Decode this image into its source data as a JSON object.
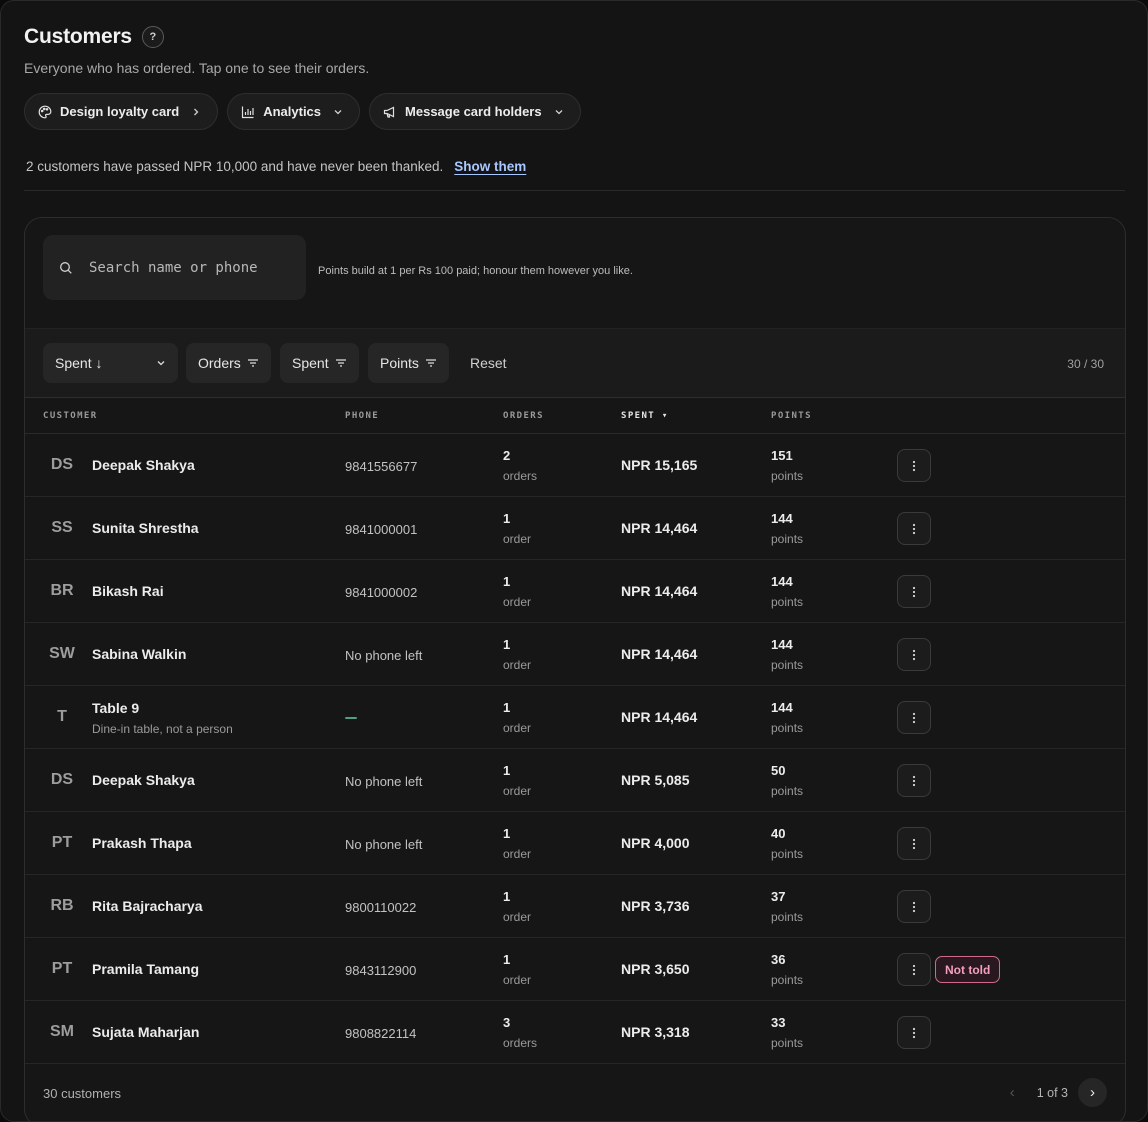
{
  "header": {
    "title": "Customers",
    "help": "?",
    "subtitle": "Everyone who has ordered. Tap one to see their orders."
  },
  "actions": [
    {
      "label": "Design loyalty card",
      "icon": "palette-icon",
      "trail": "chevron-right-icon"
    },
    {
      "label": "Analytics",
      "icon": "bar-chart-icon",
      "trail": "chevron-down-icon"
    },
    {
      "label": "Message card holders",
      "icon": "megaphone-icon",
      "trail": "chevron-down-icon"
    }
  ],
  "notice": {
    "text": "2 customers have passed NPR 10,000 and have never been thanked.",
    "link": "Show them"
  },
  "search": {
    "placeholder": "Search name or phone",
    "value": ""
  },
  "points_note": "Points build at 1 per Rs 100 paid; honour them however you like.",
  "filters": {
    "sort": "Spent ↓",
    "chips": [
      "Orders",
      "Spent",
      "Points"
    ],
    "reset": "Reset",
    "count": "30 / 30"
  },
  "columns": {
    "customer": "CUSTOMER",
    "phone": "PHONE",
    "orders": "ORDERS",
    "spent": "SPENT ▾",
    "points": "POINTS"
  },
  "rows": [
    {
      "initials": "DS",
      "name": "Deepak Shakya",
      "note": "",
      "phone": "9841556677",
      "orders": "2",
      "orders_unit": "orders",
      "spent": "NPR 15,165",
      "points": "151",
      "points_unit": "points",
      "badge": ""
    },
    {
      "initials": "SS",
      "name": "Sunita Shrestha",
      "note": "",
      "phone": "9841000001",
      "orders": "1",
      "orders_unit": "order",
      "spent": "NPR 14,464",
      "points": "144",
      "points_unit": "points",
      "badge": ""
    },
    {
      "initials": "BR",
      "name": "Bikash Rai",
      "note": "",
      "phone": "9841000002",
      "orders": "1",
      "orders_unit": "order",
      "spent": "NPR 14,464",
      "points": "144",
      "points_unit": "points",
      "badge": ""
    },
    {
      "initials": "SW",
      "name": "Sabina Walkin",
      "note": "",
      "phone": "No phone left",
      "orders": "1",
      "orders_unit": "order",
      "spent": "NPR 14,464",
      "points": "144",
      "points_unit": "points",
      "badge": ""
    },
    {
      "initials": "T",
      "name": "Table 9",
      "note": "Dine-in table, not a person",
      "phone": "",
      "orders": "1",
      "orders_unit": "order",
      "spent": "NPR 14,464",
      "points": "144",
      "points_unit": "points",
      "badge": ""
    },
    {
      "initials": "DS",
      "name": "Deepak Shakya",
      "note": "",
      "phone": "No phone left",
      "orders": "1",
      "orders_unit": "order",
      "spent": "NPR 5,085",
      "points": "50",
      "points_unit": "points",
      "badge": ""
    },
    {
      "initials": "PT",
      "name": "Prakash Thapa",
      "note": "",
      "phone": "No phone left",
      "orders": "1",
      "orders_unit": "order",
      "spent": "NPR 4,000",
      "points": "40",
      "points_unit": "points",
      "badge": ""
    },
    {
      "initials": "RB",
      "name": "Rita Bajracharya",
      "note": "",
      "phone": "9800110022",
      "orders": "1",
      "orders_unit": "order",
      "spent": "NPR 3,736",
      "points": "37",
      "points_unit": "points",
      "badge": ""
    },
    {
      "initials": "PT",
      "name": "Pramila Tamang",
      "note": "",
      "phone": "9843112900",
      "orders": "1",
      "orders_unit": "order",
      "spent": "NPR 3,650",
      "points": "36",
      "points_unit": "points",
      "badge": "Not told"
    },
    {
      "initials": "SM",
      "name": "Sujata Maharjan",
      "note": "",
      "phone": "9808822114",
      "orders": "3",
      "orders_unit": "orders",
      "spent": "NPR 3,318",
      "points": "33",
      "points_unit": "points",
      "badge": ""
    }
  ],
  "footer": {
    "count": "30 customers",
    "page": "1 of 3",
    "prev": "‹",
    "next": "›"
  }
}
